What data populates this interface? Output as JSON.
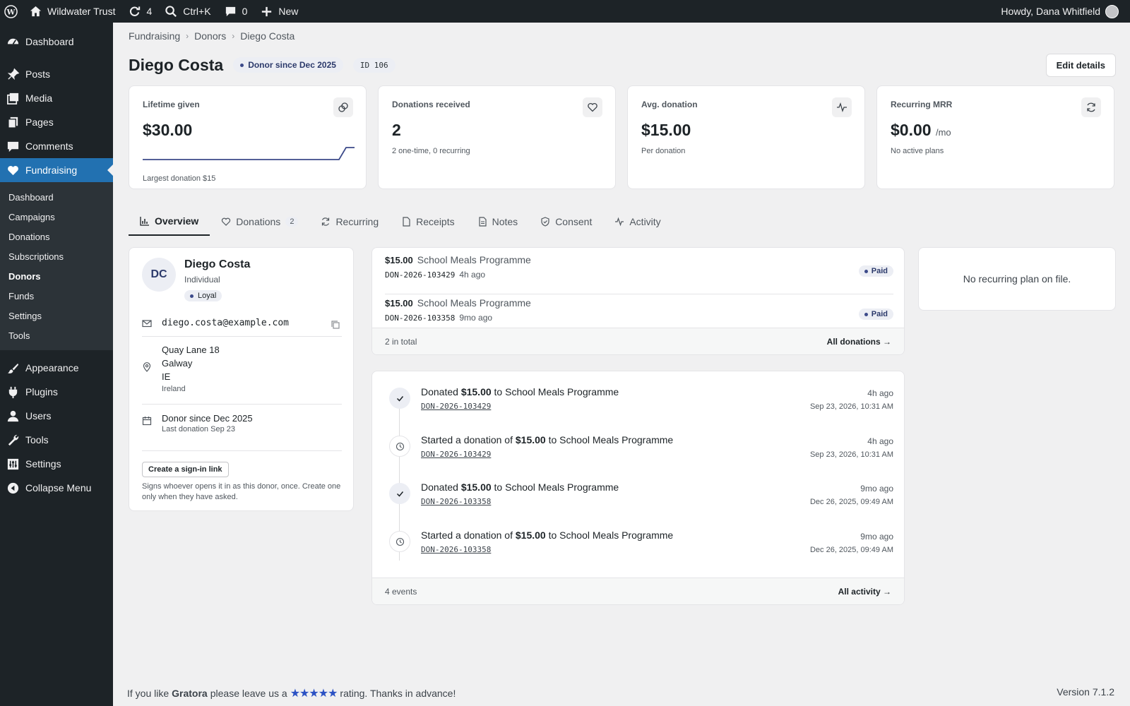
{
  "adminbar": {
    "site_name": "Wildwater Trust",
    "updates_count": "4",
    "search_shortcut": "Ctrl+K",
    "comments_count": "0",
    "new_label": "New",
    "howdy": "Howdy, Dana Whitfield"
  },
  "sidebar": {
    "top": [
      {
        "label": "Dashboard",
        "icon": "dashboard-icon"
      }
    ],
    "items": [
      {
        "label": "Posts",
        "icon": "pin-icon"
      },
      {
        "label": "Media",
        "icon": "media-icon"
      },
      {
        "label": "Pages",
        "icon": "pages-icon"
      },
      {
        "label": "Comments",
        "icon": "comment-icon"
      },
      {
        "label": "Fundraising",
        "icon": "heart-icon"
      }
    ],
    "submenu": [
      "Dashboard",
      "Campaigns",
      "Donations",
      "Subscriptions",
      "Donors",
      "Funds",
      "Settings",
      "Tools"
    ],
    "bottom": [
      {
        "label": "Appearance",
        "icon": "brush-icon"
      },
      {
        "label": "Plugins",
        "icon": "plugin-icon"
      },
      {
        "label": "Users",
        "icon": "user-icon"
      },
      {
        "label": "Tools",
        "icon": "wrench-icon"
      },
      {
        "label": "Settings",
        "icon": "settings-icon"
      },
      {
        "label": "Collapse Menu",
        "icon": "collapse-icon"
      }
    ]
  },
  "breadcrumb": [
    "Fundraising",
    "Donors",
    "Diego Costa"
  ],
  "header": {
    "title": "Diego Costa",
    "badge": "Donor since Dec 2025",
    "id_label": "ID 106",
    "edit_button": "Edit details"
  },
  "stats": [
    {
      "label": "Lifetime given",
      "value": "$30.00",
      "unit": "",
      "sub": "Largest donation $15",
      "icon": "coins-icon"
    },
    {
      "label": "Donations received",
      "value": "2",
      "unit": "",
      "sub": "2 one-time, 0 recurring",
      "icon": "heart-icon"
    },
    {
      "label": "Avg. donation",
      "value": "$15.00",
      "unit": "",
      "sub": "Per donation",
      "icon": "pulse-icon"
    },
    {
      "label": "Recurring MRR",
      "value": "$0.00",
      "unit": "/mo",
      "sub": "No active plans",
      "icon": "refresh-icon"
    }
  ],
  "tabs": [
    {
      "label": "Overview",
      "icon": "chart-icon",
      "count": ""
    },
    {
      "label": "Donations",
      "icon": "heart-icon",
      "count": "2"
    },
    {
      "label": "Recurring",
      "icon": "refresh-icon",
      "count": ""
    },
    {
      "label": "Receipts",
      "icon": "file-icon",
      "count": ""
    },
    {
      "label": "Notes",
      "icon": "note-icon",
      "count": ""
    },
    {
      "label": "Consent",
      "icon": "shield-icon",
      "count": ""
    },
    {
      "label": "Activity",
      "icon": "pulse-icon",
      "count": ""
    }
  ],
  "profile": {
    "initials": "DC",
    "name": "Diego Costa",
    "type": "Individual",
    "tag": "Loyal",
    "email": "diego.costa@example.com",
    "address": [
      "Quay Lane 18",
      "Galway",
      "IE"
    ],
    "country": "Ireland",
    "since": "Donor since Dec 2025",
    "last_donation": "Last donation Sep 23",
    "signin_button": "Create a sign-in link",
    "signin_note": "Signs whoever opens it in as this donor, once. Create one only when they have asked."
  },
  "donations": {
    "rows": [
      {
        "amount": "$15.00",
        "campaign": "School Meals Programme",
        "id": "DON-2026-103429",
        "ago": "4h ago",
        "status": "Paid"
      },
      {
        "amount": "$15.00",
        "campaign": "School Meals Programme",
        "id": "DON-2026-103358",
        "ago": "9mo ago",
        "status": "Paid"
      }
    ],
    "total": "2 in total",
    "all_link": "All donations →"
  },
  "activity": {
    "events": [
      {
        "prefix": "Donated ",
        "amount": "$15.00",
        "suffix": " to School Meals Programme",
        "id": "DON-2026-103429",
        "ago": "4h ago",
        "date": "Sep 23, 2026, 10:31 AM",
        "icon": "check-icon"
      },
      {
        "prefix": "Started a donation of ",
        "amount": "$15.00",
        "suffix": " to School Meals Programme",
        "id": "DON-2026-103429",
        "ago": "4h ago",
        "date": "Sep 23, 2026, 10:31 AM",
        "icon": "clock-icon"
      },
      {
        "prefix": "Donated ",
        "amount": "$15.00",
        "suffix": " to School Meals Programme",
        "id": "DON-2026-103358",
        "ago": "9mo ago",
        "date": "Dec 26, 2025, 09:49 AM",
        "icon": "check-icon"
      },
      {
        "prefix": "Started a donation of ",
        "amount": "$15.00",
        "suffix": " to School Meals Programme",
        "id": "DON-2026-103358",
        "ago": "9mo ago",
        "date": "Dec 26, 2025, 09:49 AM",
        "icon": "clock-icon"
      }
    ],
    "count": "4 events",
    "all_link": "All activity →"
  },
  "recurring": {
    "empty": "No recurring plan on file."
  },
  "footer": {
    "prefix": "If you like",
    "brand": "Gratora",
    "middle": "please leave us a",
    "stars": "★★★★★",
    "suffix": "rating. Thanks in advance!",
    "version": "Version 7.1.2"
  },
  "colors": {
    "sidebar_bg": "#1d2327",
    "accent": "#2271b1",
    "badge_bg": "#eceef4"
  }
}
